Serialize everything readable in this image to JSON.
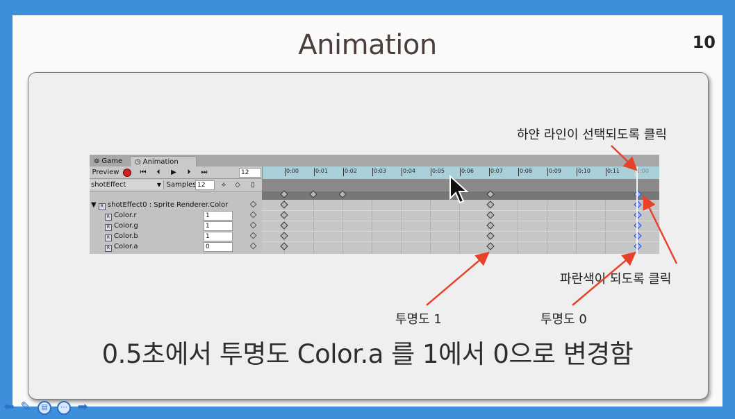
{
  "slide": {
    "title": "Animation",
    "page_number": "10",
    "caption": "0.5초에서 투명도 Color.a 를 1에서 0으로 변경함"
  },
  "annotations": {
    "white_line": "하얀 라인이 선택되도록 클릭",
    "blue": "파란색이 되도록 클릭",
    "alpha1": "투명도 1",
    "alpha0": "투명도 0"
  },
  "unity": {
    "tabs": [
      {
        "label": "Game",
        "icon": "gamepad-icon"
      },
      {
        "label": "Animation",
        "icon": "clock-icon"
      }
    ],
    "toolbar": {
      "preview_label": "Preview",
      "frame_value": "12"
    },
    "clip": {
      "name": "shotEffect",
      "samples_label": "Samples",
      "samples_value": "12"
    },
    "properties": [
      {
        "label": "shotEffect0 : Sprite Renderer.Color",
        "value": ""
      },
      {
        "label": "Color.r",
        "value": "1"
      },
      {
        "label": "Color.g",
        "value": "1"
      },
      {
        "label": "Color.b",
        "value": "1"
      },
      {
        "label": "Color.a",
        "value": "0"
      }
    ],
    "timeline_ticks": [
      "0:00",
      "0:01",
      "0:02",
      "0:03",
      "0:04",
      "0:05",
      "0:06",
      "0:07",
      "0:08",
      "0:09",
      "0:10",
      "0:11",
      "1:00"
    ]
  },
  "colors": {
    "annotation_arrow": "#e8412a",
    "keyframe_selected": "#1e4fd6",
    "background": "#3d8fdc"
  }
}
